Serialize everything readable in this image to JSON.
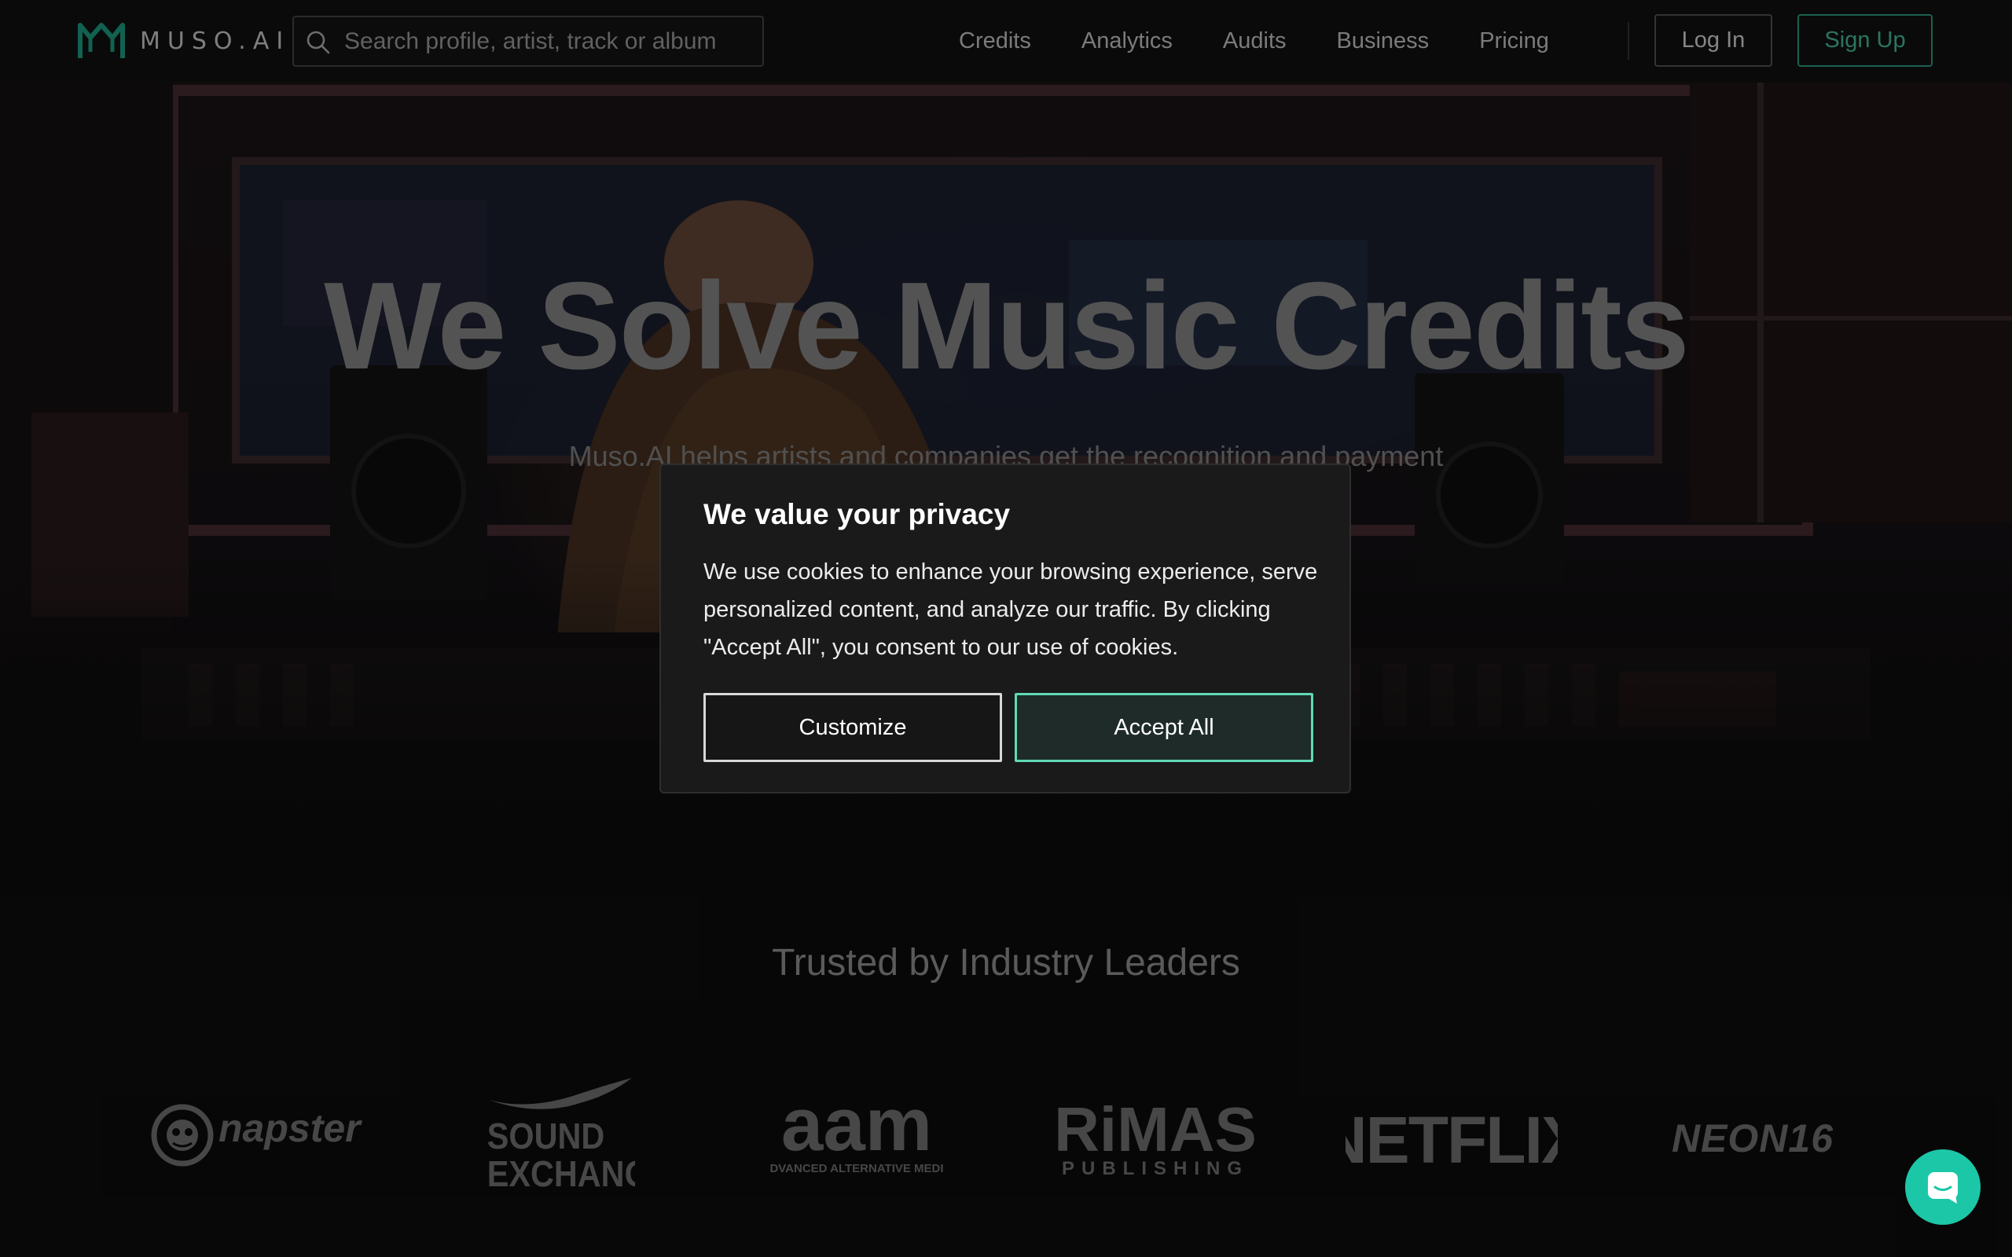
{
  "header": {
    "logo_text": "MUSO.AI",
    "search_placeholder": "Search profile, artist, track or album",
    "nav": [
      "Credits",
      "Analytics",
      "Audits",
      "Business",
      "Pricing"
    ],
    "login_label": "Log In",
    "signup_label": "Sign Up"
  },
  "hero": {
    "title": "We Solve Music Credits",
    "subtitle": "Muso.AI helps artists and companies get the recognition and payment"
  },
  "trusted": {
    "title": "Trusted by Industry Leaders",
    "logos": [
      {
        "name": "napster",
        "text": "napster"
      },
      {
        "name": "soundexchange",
        "line1": "SOUND",
        "line2": "EXCHANGE"
      },
      {
        "name": "aam",
        "text": "aam",
        "caption": "ADVANCED ALTERNATIVE MEDIA"
      },
      {
        "name": "rimas",
        "text": "RiMAS",
        "caption": "PUBLISHING"
      },
      {
        "name": "netflix",
        "text": "NETFLIX"
      },
      {
        "name": "neon16",
        "text": "NEON16"
      }
    ]
  },
  "cookie_modal": {
    "title": "We value your privacy",
    "body": "We use cookies to enhance your browsing experience, serve personalized content, and analyze our traffic. By clicking \"Accept All\", you consent to our use of cookies.",
    "customize_label": "Customize",
    "accept_label": "Accept All"
  },
  "colors": {
    "accent": "#4cc9a6",
    "accept_border": "#5fd9b5",
    "chat_button": "#1cc7a8",
    "logo_teal": "#1fa98c"
  },
  "icons": {
    "search": "search-icon",
    "chat": "chat-icon",
    "logo": "muso-logo-icon"
  }
}
